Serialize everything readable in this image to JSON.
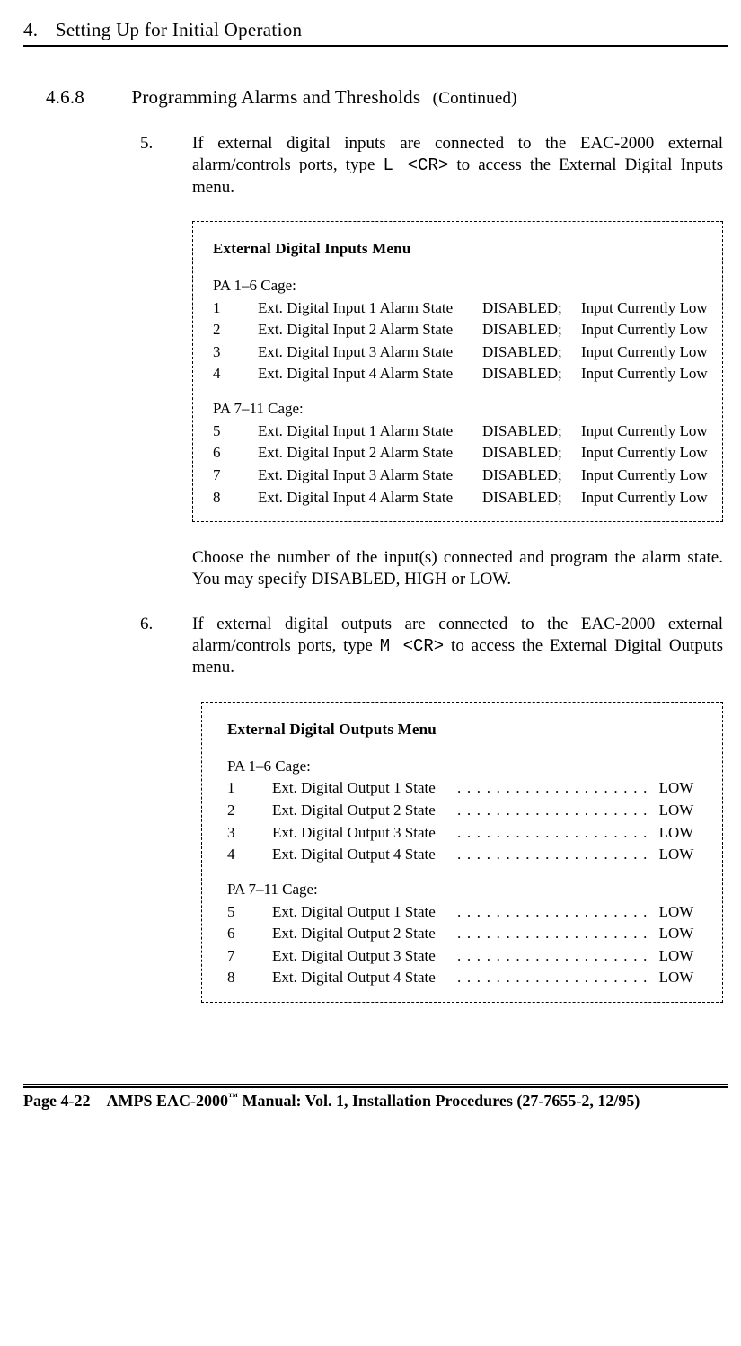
{
  "chapter": {
    "number": "4.",
    "title": "Setting Up for Initial Operation"
  },
  "section": {
    "number": "4.6.8",
    "title": "Programming Alarms and Thresholds",
    "continued": "(Continued)"
  },
  "steps": {
    "s5": {
      "num": "5.",
      "text_a": "If external digital inputs are connected to the EAC-2000 external alarm/controls ports, type ",
      "cmd": "L <CR>",
      "text_b": " to access the External Digital Inputs menu."
    },
    "s5b": {
      "text": "Choose the number of the input(s) connected and program the alarm state.  You may specify DISABLED, HIGH or LOW."
    },
    "s6": {
      "num": "6.",
      "text_a": "If external digital outputs are connected to the EAC-2000 external alarm/controls ports, type ",
      "cmd": "M <CR>",
      "text_b": " to access the External Digital Outputs menu."
    }
  },
  "menu1": {
    "title": "External Digital Inputs Menu",
    "cage1": "PA 1–6 Cage:",
    "cage2": "PA 7–11 Cage:",
    "rows": [
      {
        "n": "1",
        "label": "Ext. Digital Input 1 Alarm State",
        "state": "DISABLED;",
        "status": "Input Currently Low"
      },
      {
        "n": "2",
        "label": "Ext. Digital Input 2 Alarm State",
        "state": "DISABLED;",
        "status": "Input Currently Low"
      },
      {
        "n": "3",
        "label": "Ext. Digital Input 3 Alarm State",
        "state": "DISABLED;",
        "status": "Input Currently Low"
      },
      {
        "n": "4",
        "label": "Ext. Digital Input 4 Alarm State",
        "state": "DISABLED;",
        "status": "Input Currently Low"
      },
      {
        "n": "5",
        "label": "Ext. Digital Input 1 Alarm State",
        "state": "DISABLED;",
        "status": "Input Currently Low"
      },
      {
        "n": "6",
        "label": "Ext. Digital Input 2 Alarm State",
        "state": "DISABLED;",
        "status": "Input Currently Low"
      },
      {
        "n": "7",
        "label": "Ext. Digital Input 3 Alarm State",
        "state": "DISABLED;",
        "status": "Input Currently Low"
      },
      {
        "n": "8",
        "label": "Ext. Digital Input 4 Alarm State",
        "state": "DISABLED;",
        "status": "Input Currently Low"
      }
    ]
  },
  "menu2": {
    "title": "External Digital Outputs Menu",
    "cage1": "PA 1–6 Cage:",
    "cage2": "PA 7–11 Cage:",
    "dots": ". . . . . . . . . . . . . . . . . . . .",
    "rows": [
      {
        "n": "1",
        "label": "Ext. Digital Output 1 State",
        "state": "LOW"
      },
      {
        "n": "2",
        "label": "Ext. Digital Output 2 State",
        "state": "LOW"
      },
      {
        "n": "3",
        "label": "Ext. Digital Output 3 State",
        "state": "LOW"
      },
      {
        "n": "4",
        "label": "Ext. Digital Output 4 State",
        "state": "LOW"
      },
      {
        "n": "5",
        "label": "Ext. Digital Output 1 State",
        "state": "LOW"
      },
      {
        "n": "6",
        "label": "Ext. Digital Output 2 State",
        "state": "LOW"
      },
      {
        "n": "7",
        "label": "Ext. Digital Output 3 State",
        "state": "LOW"
      },
      {
        "n": "8",
        "label": "Ext. Digital Output 4 State",
        "state": "LOW"
      }
    ]
  },
  "footer": {
    "page": "Page 4-22",
    "prefix": "AMPS EAC-2000",
    "tm": "™",
    "suffix": " Manual:  Vol. 1, Installation Procedures (27-7655-2, 12/95)"
  }
}
